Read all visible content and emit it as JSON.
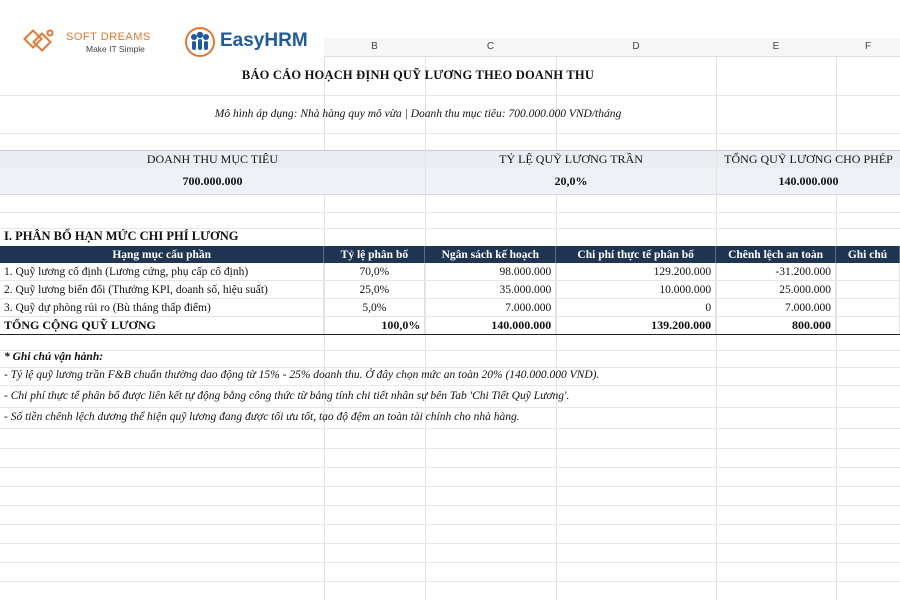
{
  "logos": {
    "softdreams_name": "SOFT DREAMS",
    "softdreams_tagline": "Make IT Simple",
    "easyhrm_name": "EasyHRM"
  },
  "columns": [
    "B",
    "C",
    "D",
    "E",
    "F"
  ],
  "report": {
    "title": "BÁO CÁO HOẠCH ĐỊNH QUỸ LƯƠNG THEO DOANH THU",
    "subtitle": "Mô hình áp dụng: Nhà hàng quy mô vừa | Doanh thu mục tiêu: 700.000.000 VND/tháng"
  },
  "kpis": [
    {
      "label": "DOANH THU MỤC TIÊU",
      "value": "700.000.000"
    },
    {
      "label": "TỶ LỆ QUỸ LƯƠNG TRẦN",
      "value": "20,0%"
    },
    {
      "label": "TỔNG QUỸ LƯƠNG CHO PHÉP",
      "value": "140.000.000"
    }
  ],
  "section_title": "I. PHÂN BỔ HẠN MỨC CHI PHÍ LƯƠNG",
  "table": {
    "headers": [
      "Hạng mục cấu phần",
      "Tỷ lệ phân bổ",
      "Ngân sách kế hoạch",
      "Chi phí thực tế phân bổ",
      "Chênh lệch an toàn",
      "Ghi chú"
    ],
    "rows": [
      [
        "1. Quỹ lương cố định (Lương cứng, phụ cấp cố định)",
        "70,0%",
        "98.000.000",
        "129.200.000",
        "-31.200.000",
        ""
      ],
      [
        "2. Quỹ lương biến đổi (Thưởng KPI, doanh số, hiệu suất)",
        "25,0%",
        "35.000.000",
        "10.000.000",
        "25.000.000",
        ""
      ],
      [
        "3. Quỹ dự phòng rủi ro (Bù tháng thấp điểm)",
        "5,0%",
        "7.000.000",
        "0",
        "7.000.000",
        ""
      ]
    ],
    "total": [
      "TỔNG CỘNG QUỸ LƯƠNG",
      "100,0%",
      "140.000.000",
      "139.200.000",
      "800.000",
      ""
    ]
  },
  "notes": {
    "title": "* Ghi chú vận hành:",
    "items": [
      "- Tỷ lệ quỹ lương trần F&B chuẩn thường dao động từ 15% - 25% doanh thu. Ở đây chọn mức an toàn 20% (140.000.000 VND).",
      "- Chi phí thực tế phân bổ được liên kết tự động bằng công thức từ bảng tính chi tiết nhân sự bên Tab 'Chi Tiết Quỹ Lương'.",
      "- Số tiền chênh lệch dương thể hiện quỹ lương đang được tối ưu tốt, tạo độ đệm an toàn tài chính cho nhà hàng."
    ]
  },
  "colors": {
    "header_bg": "#1f3552",
    "kpi_bg": "#eaeef3",
    "accent_blue": "#1e5aa8",
    "accent_orange": "#e8762d"
  }
}
